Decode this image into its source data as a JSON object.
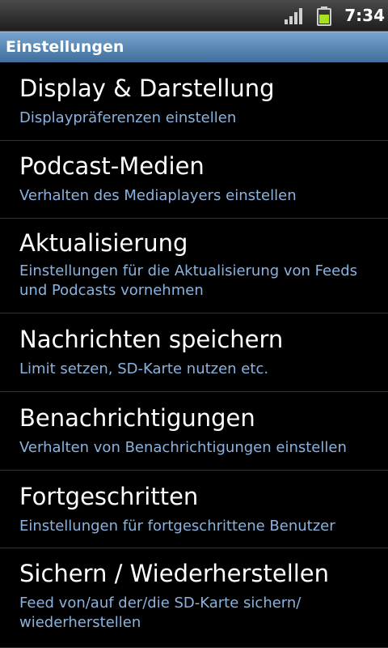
{
  "status_bar": {
    "time": "7:34",
    "signal_icon": "signal-bars-icon",
    "battery_icon": "battery-icon",
    "battery_color": "#a9e21c"
  },
  "title_bar": {
    "title": "Einstellungen"
  },
  "colors": {
    "title_bar_top": "#77a4cf",
    "title_bar_bottom": "#3f6e9c",
    "summary_text": "#8ab3df",
    "background": "#000000"
  },
  "settings": [
    {
      "title": "Display & Darstellung",
      "summary": "Displaypräferenzen einstellen"
    },
    {
      "title": "Podcast-Medien",
      "summary": "Verhalten des Mediaplayers einstellen"
    },
    {
      "title": "Aktualisierung",
      "summary": "Einstellungen für die Aktualisierung von Feeds und Podcasts vornehmen"
    },
    {
      "title": "Nachrichten speichern",
      "summary": "Limit setzen, SD-Karte nutzen etc."
    },
    {
      "title": "Benachrichtigungen",
      "summary": "Verhalten von Benachrichtigungen einstellen"
    },
    {
      "title": "Fortgeschritten",
      "summary": "Einstellungen für fortgeschrittene Benutzer"
    },
    {
      "title": "Sichern / Wiederherstellen",
      "summary": "Feed von/auf der/die SD-Karte sichern/ wiederherstellen"
    }
  ]
}
